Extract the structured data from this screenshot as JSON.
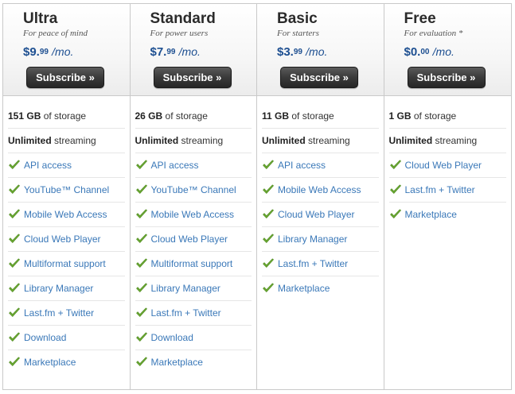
{
  "plans": [
    {
      "name": "Ultra",
      "tagline": "For peace of mind",
      "price_main": "$9.",
      "price_cents": "99",
      "price_per": "/mo.",
      "subscribe_label": "Subscribe »",
      "storage_amount": "151 GB",
      "storage_suffix": " of storage",
      "streaming_bold": "Unlimited",
      "streaming_suffix": " streaming",
      "features": [
        "API access",
        "YouTube™ Channel",
        "Mobile Web Access",
        "Cloud Web Player",
        "Multiformat support",
        "Library Manager",
        "Last.fm + Twitter",
        "Download",
        "Marketplace"
      ]
    },
    {
      "name": "Standard",
      "tagline": "For power users",
      "price_main": "$7.",
      "price_cents": "99",
      "price_per": "/mo.",
      "subscribe_label": "Subscribe »",
      "storage_amount": "26 GB",
      "storage_suffix": " of storage",
      "streaming_bold": "Unlimited",
      "streaming_suffix": " streaming",
      "features": [
        "API access",
        "YouTube™ Channel",
        "Mobile Web Access",
        "Cloud Web Player",
        "Multiformat support",
        "Library Manager",
        "Last.fm + Twitter",
        "Download",
        "Marketplace"
      ]
    },
    {
      "name": "Basic",
      "tagline": "For starters",
      "price_main": "$3.",
      "price_cents": "99",
      "price_per": "/mo.",
      "subscribe_label": "Subscribe »",
      "storage_amount": "11 GB",
      "storage_suffix": " of storage",
      "streaming_bold": "Unlimited",
      "streaming_suffix": " streaming",
      "features": [
        "API access",
        "Mobile Web Access",
        "Cloud Web Player",
        "Library Manager",
        "Last.fm + Twitter",
        "Marketplace"
      ]
    },
    {
      "name": "Free",
      "tagline": "For evaluation *",
      "price_main": "$0.",
      "price_cents": "00",
      "price_per": "/mo.",
      "subscribe_label": "Subscribe »",
      "storage_amount": "1 GB",
      "storage_suffix": " of storage",
      "streaming_bold": "Unlimited",
      "streaming_suffix": " streaming",
      "features": [
        "Cloud Web Player",
        "Last.fm + Twitter",
        "Marketplace"
      ]
    }
  ],
  "colors": {
    "link": "#3a78b8",
    "price": "#1d4f91",
    "check": "#6aa832",
    "button": "#333333"
  },
  "icons": {
    "feature_check": "check-icon"
  }
}
